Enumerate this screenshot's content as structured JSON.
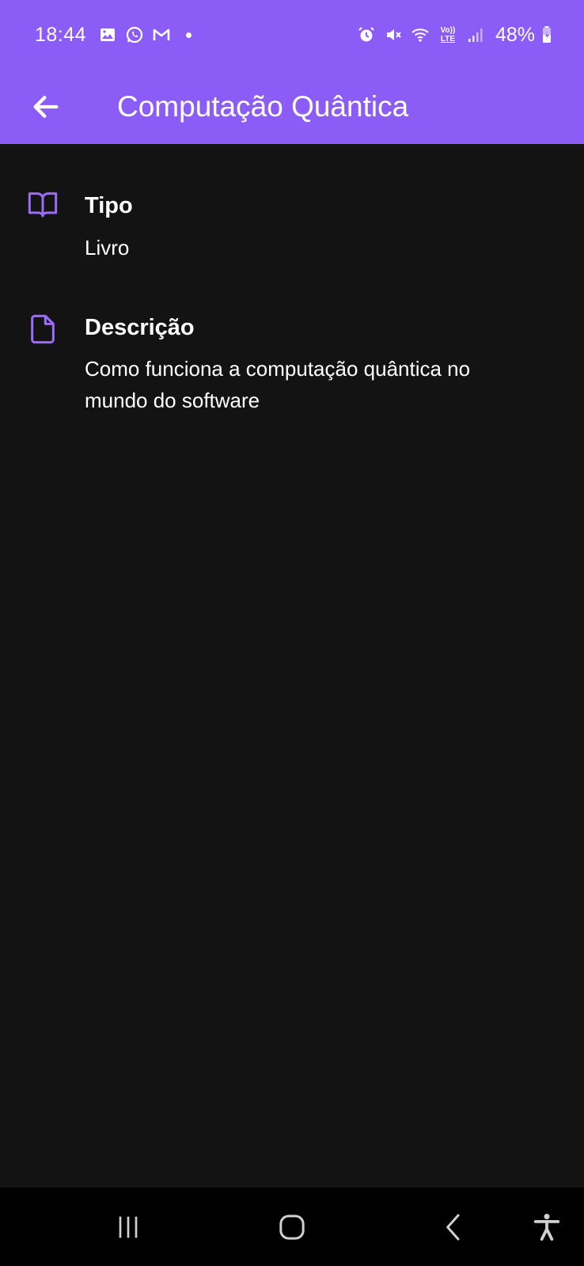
{
  "status_bar": {
    "time": "18:44",
    "battery": "48%",
    "left_icons": [
      "gallery-icon",
      "whatsapp-icon",
      "gmail-icon",
      "notification-dot"
    ],
    "right_icons": [
      "alarm-icon",
      "mute-icon",
      "wifi-icon",
      "volte-icon",
      "signal-icon",
      "battery-icon"
    ],
    "volte_label_top": "Vo))",
    "volte_label_bottom": "LTE"
  },
  "app_bar": {
    "title": "Computação Quântica",
    "back_icon": "arrow-left-icon",
    "background": "#8b5cf6"
  },
  "details": [
    {
      "icon": "book-open-icon",
      "label": "Tipo",
      "value": "Livro"
    },
    {
      "icon": "file-icon",
      "label": "Descrição",
      "value": "Como funciona a computação quântica no mundo do software"
    }
  ],
  "nav_bar": {
    "buttons": [
      "recent-apps-icon",
      "home-icon",
      "back-icon",
      "accessibility-icon"
    ]
  },
  "colors": {
    "accent": "#8b5cf6",
    "icon_accent": "#9b6cf6",
    "background": "#131313"
  }
}
